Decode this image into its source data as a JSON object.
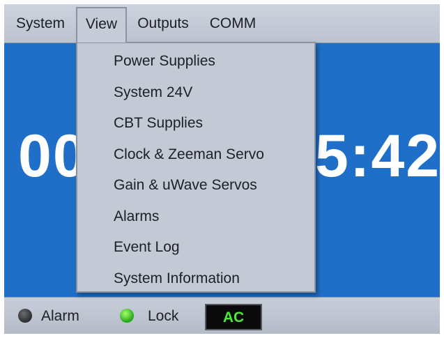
{
  "menubar": {
    "items": [
      {
        "label": "System"
      },
      {
        "label": "View"
      },
      {
        "label": "Outputs"
      },
      {
        "label": "COMM"
      }
    ]
  },
  "background_clock": {
    "left_fragment": "00",
    "right_fragment": "5:42"
  },
  "view_menu": {
    "items": [
      {
        "label": "Power Supplies"
      },
      {
        "label": "System 24V"
      },
      {
        "label": "CBT Supplies"
      },
      {
        "label": "Clock & Zeeman Servo"
      },
      {
        "label": "Gain & uWave Servos"
      },
      {
        "label": "Alarms"
      },
      {
        "label": "Event Log"
      },
      {
        "label": "System Information"
      }
    ]
  },
  "statusbar": {
    "alarm": {
      "label": "Alarm",
      "state": "off",
      "color": "#2c2d30"
    },
    "lock": {
      "label": "Lock",
      "state": "on",
      "color": "#1ea61a"
    },
    "power_indicator": {
      "label": "AC",
      "color": "#4bea3a"
    }
  },
  "colors": {
    "background": "#1f6fc8",
    "menu": "#c3cad6"
  }
}
